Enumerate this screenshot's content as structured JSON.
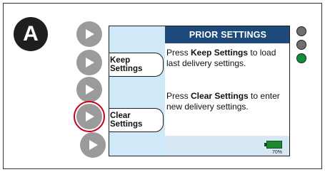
{
  "badge": "A",
  "screen": {
    "title": "PRIOR SETTINGS",
    "softkeys": {
      "keep": [
        "Keep",
        "Settings"
      ],
      "clear": [
        "Clear",
        "Settings"
      ]
    },
    "message1": {
      "pre": "Press ",
      "bold": "Keep Settings",
      "post": " to load last delivery settings."
    },
    "message2": {
      "pre": "Press ",
      "bold": "Clear Settings",
      "post": " to enter new delivery settings."
    },
    "battery": {
      "level_percent": 70,
      "label": "70%",
      "color": "#1b8a2e"
    }
  },
  "leds": [
    {
      "name": "gray",
      "color": "#6f6f6f"
    },
    {
      "name": "gray",
      "color": "#6f6f6f"
    },
    {
      "name": "green",
      "color": "#0e8f3a"
    }
  ],
  "colors": {
    "title_bar": "#1d4a7a",
    "screen_left": "#cfe9f8",
    "highlight_ring": "#c4001a",
    "softkey_button": "#9b9b9b"
  }
}
